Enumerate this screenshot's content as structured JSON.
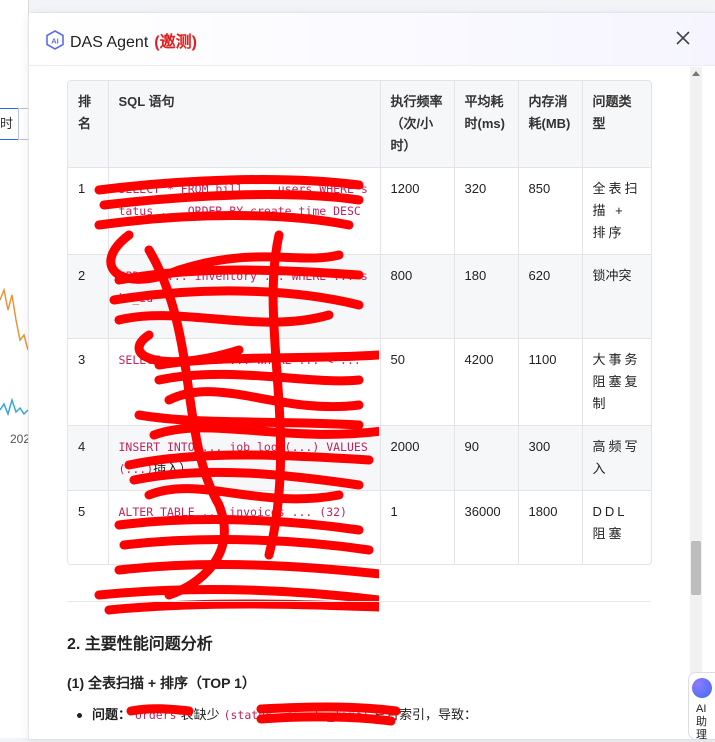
{
  "background": {
    "tab_label": "时",
    "axis_year": "202"
  },
  "dialog": {
    "title": "DAS Agent",
    "badge": "(邀测)",
    "close_icon": "close-icon",
    "logo_icon": "ai-logo-icon"
  },
  "table": {
    "headers": [
      "排名",
      "SQL 语句",
      "执行频率（次/小时）",
      "平均耗时(ms)",
      "内存消耗(MB)",
      "问题类型"
    ],
    "rows": [
      {
        "rank": "1",
        "sql": "SELECT * FROM bill ... users WHERE status ... ORDER BY create_time DESC",
        "freq": "1200",
        "avg": "320",
        "mem": "850",
        "type": "全表扫描 + 排序"
      },
      {
        "rank": "2",
        "sql": "UPDATE ... inventory ... WHERE ... sku_id",
        "freq": "800",
        "avg": "180",
        "mem": "620",
        "type": "锁冲突"
      },
      {
        "rank": "3",
        "sql": "SELECT ... FROM ... WHERE ... < ...",
        "freq": "50",
        "avg": "4200",
        "mem": "1100",
        "type": "大事务阻塞复制"
      },
      {
        "rank": "4",
        "sql": "INSERT INTO ... job_log (...) VALUES (...)",
        "sql_tail": "插入）",
        "freq": "2000",
        "avg": "90",
        "mem": "300",
        "type": "高频写入"
      },
      {
        "rank": "5",
        "sql": "ALTER TABLE ... invoices ... (32)",
        "freq": "1",
        "avg": "36000",
        "mem": "1800",
        "type": "DDL 阻塞"
      }
    ]
  },
  "section": {
    "h2": "2. 主要性能问题分析",
    "h3": "(1) 全表扫描 + 排序（TOP 1）",
    "bullet_key": "问题：",
    "bullet_code1": "orders",
    "bullet_mid": "表缺少",
    "bullet_code2": "(status, create_time)",
    "bullet_tail": "复合索引，导致："
  },
  "ai_helper": {
    "label": "AI助理",
    "icon": "ai-sparkle-icon"
  },
  "colors": {
    "accent": "#2a6cf0",
    "beta_red": "#e02020",
    "code_pink": "#c0245c",
    "redaction": "#ff0000"
  }
}
